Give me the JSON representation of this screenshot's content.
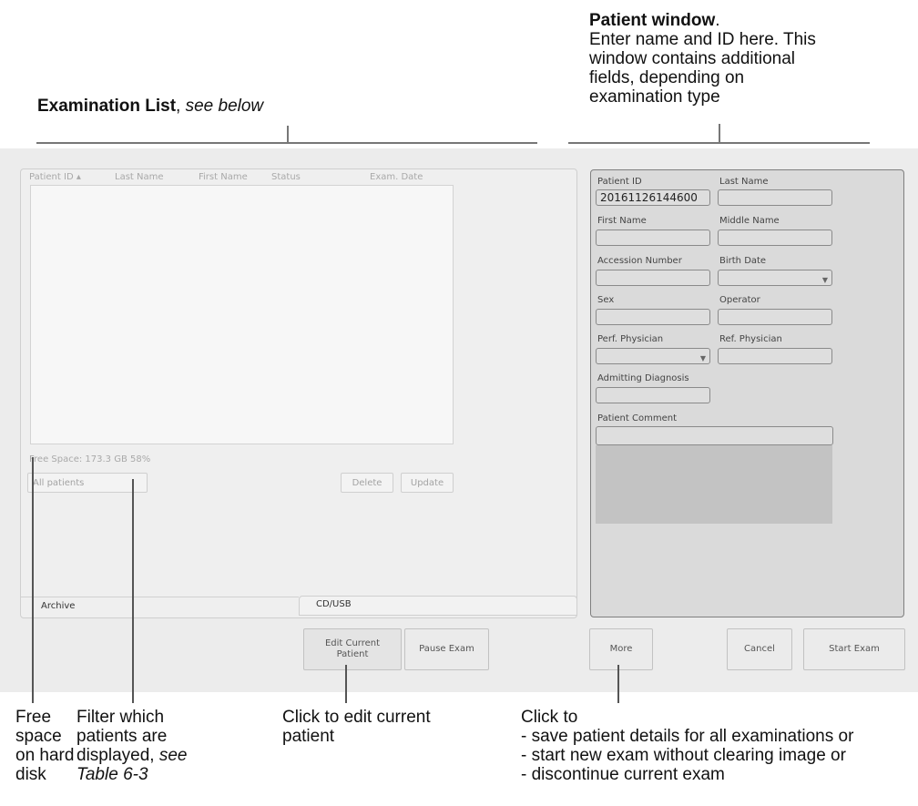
{
  "annotations": {
    "exam_list": {
      "bold": "Examination List",
      "rest": ", ",
      "italic": "see below"
    },
    "patient_window": {
      "title": "Patient window",
      "period": ".",
      "lines": [
        "Enter name and ID here. This",
        "window contains additional",
        "fields, depending on",
        "examination type"
      ]
    },
    "free_space": [
      "Free",
      "space",
      "on hard",
      "disk"
    ],
    "filter": {
      "lines": [
        "Filter which",
        "patients are"
      ],
      "line3": "displayed, ",
      "line3_italic": "see",
      "line4_italic": "Table 6-3"
    },
    "edit_current": [
      "Click to edit current",
      "patient"
    ],
    "more": [
      "Click to",
      "- save patient details for all examinations or",
      "- start new exam without clearing image or",
      "- discontinue current exam"
    ]
  },
  "exam_list": {
    "columns": [
      "Patient ID ▴",
      "Last Name",
      "First Name",
      "Status",
      "Exam. Date"
    ],
    "rows": [],
    "free_space": "Free Space: 173.3 GB  58%",
    "filter_value": "All patients",
    "delete_label": "Delete",
    "update_label": "Update",
    "tabs": [
      "Archive",
      "CD/USB"
    ]
  },
  "patient": {
    "patient_id_label": "Patient ID",
    "patient_id_value": "20161126144600",
    "last_name_label": "Last Name",
    "last_name_value": "",
    "first_name_label": "First Name",
    "first_name_value": "",
    "middle_name_label": "Middle Name",
    "middle_name_value": "",
    "accession_label": "Accession Number",
    "accession_value": "",
    "birth_date_label": "Birth Date",
    "birth_date_value": "",
    "sex_label": "Sex",
    "sex_value": "",
    "operator_label": "Operator",
    "operator_value": "",
    "perf_physician_label": "Perf. Physician",
    "perf_physician_value": "",
    "ref_physician_label": "Ref. Physician",
    "ref_physician_value": "",
    "admitting_label": "Admitting Diagnosis",
    "admitting_value": "",
    "comment_label": "Patient Comment",
    "comment_value": ""
  },
  "buttons": {
    "edit_current": [
      "Edit Current",
      "Patient"
    ],
    "pause": "Pause Exam",
    "more": "More",
    "cancel": "Cancel",
    "start": "Start Exam"
  },
  "colors": {
    "panel_bg": "#efefef",
    "patient_panel_bg": "#dadada",
    "screen_bg": "#ececec"
  }
}
